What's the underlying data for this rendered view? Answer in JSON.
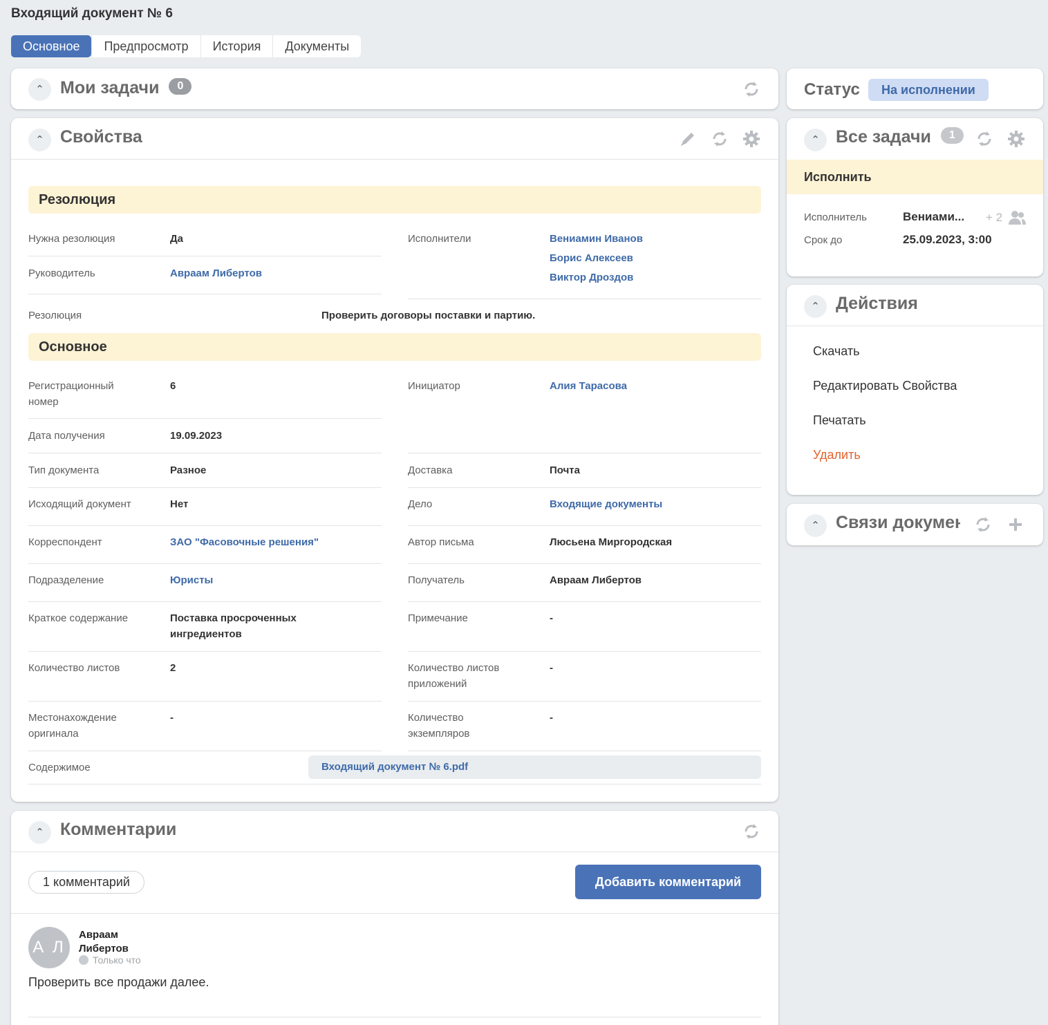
{
  "page": {
    "title": "Входящий документ № 6"
  },
  "tabs": [
    {
      "label": "Основное",
      "active": true
    },
    {
      "label": "Предпросмотр",
      "active": false
    },
    {
      "label": "История",
      "active": false
    },
    {
      "label": "Документы",
      "active": false
    }
  ],
  "my_tasks": {
    "title": "Мои задачи",
    "count": "0"
  },
  "properties": {
    "title": "Свойства",
    "resolution_section": {
      "title": "Резолюция",
      "need_label": "Нужна резолюция",
      "need_value": "Да",
      "manager_label": "Руководитель",
      "manager_value": "Авраам Либертов",
      "executors_label": "Исполнители",
      "executors": [
        "Вениамин Иванов",
        "Борис Алексеев",
        "Виктор Дроздов"
      ],
      "resolution_label": "Резолюция",
      "resolution_value": "Проверить договоры поставки и партию."
    },
    "main_section": {
      "title": "Основное",
      "reg_label": "Регистрационный номер",
      "reg_value": "6",
      "initiator_label": "Инициатор",
      "initiator_value": "Алия Тарасова",
      "date_label": "Дата получения",
      "date_value": "19.09.2023",
      "doctype_label": "Тип документа",
      "doctype_value": "Разное",
      "delivery_label": "Доставка",
      "delivery_value": "Почта",
      "outgoing_label": "Исходящий документ",
      "outgoing_value": "Нет",
      "case_label": "Дело",
      "case_value": "Входящие документы",
      "correspondent_label": "Корреспондент",
      "correspondent_value": "ЗАО \"Фасовочные решения\"",
      "author_label": "Автор письма",
      "author_value": "Люсьена Миргородская",
      "division_label": "Подразделение",
      "division_value": "Юристы",
      "recipient_label": "Получатель",
      "recipient_value": "Авраам Либертов",
      "summary_label": "Краткое содержание",
      "summary_value": "Поставка просроченных ингредиентов",
      "note_label": "Примечание",
      "note_value": "-",
      "sheets_label": "Количество листов",
      "sheets_value": "2",
      "app_sheets_label": "Количество листов приложений",
      "app_sheets_value": "-",
      "location_label": "Местонахождение оригинала",
      "location_value": "-",
      "copies_label": "Количество экземпляров",
      "copies_value": "-",
      "content_label": "Содержимое",
      "content_file": "Входящий документ № 6.pdf"
    }
  },
  "comments": {
    "title": "Комментарии",
    "count_label": "1 комментарий",
    "add_button": "Добавить комментарий",
    "items": [
      {
        "initials": "А Л",
        "author": "Авраам Либертов",
        "time": "Только что",
        "text": "Проверить все продажи далее."
      }
    ]
  },
  "status": {
    "label": "Статус",
    "value": "На исполнении"
  },
  "all_tasks": {
    "title": "Все задачи",
    "count": "1",
    "task_name": "Исполнить",
    "executor_label": "Исполнитель",
    "executor_value": "Вениами...",
    "executor_more": "+ 2",
    "due_label": "Срок до",
    "due_value": "25.09.2023, 3:00"
  },
  "actions": {
    "title": "Действия",
    "items": [
      {
        "label": "Скачать"
      },
      {
        "label": "Редактировать Свойства"
      },
      {
        "label": "Печатать"
      },
      {
        "label": "Удалить"
      }
    ]
  },
  "links": {
    "title": "Связи докумен"
  },
  "colors": {
    "accent": "#4a73b7",
    "link": "#3f6aa8",
    "band": "#fdf3d5",
    "danger": "#e2622b",
    "background": "#e9edf0"
  },
  "icons": [
    "chevron-up-icon",
    "refresh-icon",
    "pencil-icon",
    "gear-icon",
    "users-icon",
    "plus-icon",
    "clock-icon"
  ]
}
